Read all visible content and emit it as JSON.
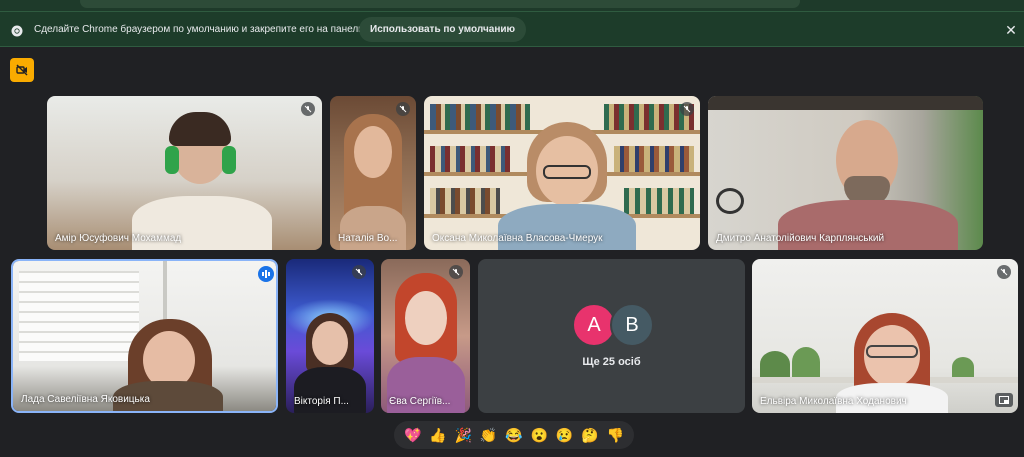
{
  "banner": {
    "message": "Сделайте Chrome браузером по умолчанию и закрепите его на панели задач.",
    "button_label": "Использовать по умолчанию",
    "close_glyph": "✕"
  },
  "participants": [
    {
      "name": "Амір Юсуфович Мохаммад",
      "muted": true
    },
    {
      "name": "Наталія Во...",
      "muted": true
    },
    {
      "name": "Оксана Миколаївна Власова-Чмерук",
      "muted": true
    },
    {
      "name": "Дмитро Анатолійович Карплянський",
      "muted": true
    },
    {
      "name": "Лада Савеліївна Яковицька",
      "speaking": true
    },
    {
      "name": "Вікторія П...",
      "muted": true
    },
    {
      "name": "Єва Сергіїв...",
      "muted": true
    },
    {
      "name": "Ельвіра Миколаївна Ходанович",
      "muted": true
    }
  ],
  "more_tile": {
    "avatars": [
      {
        "letter": "A",
        "color": "#e8336d"
      },
      {
        "letter": "B",
        "color": "#455a64"
      }
    ],
    "label": "Ще 25 осіб"
  },
  "reactions": [
    "💖",
    "👍",
    "🎉",
    "👏",
    "😂",
    "😮",
    "😢",
    "🤔",
    "👎"
  ],
  "colors": {
    "banner_bg": "#1d3c2a",
    "page_bg": "#202124",
    "speaking_border": "#8ab4f8",
    "badge": "#f9ab00"
  }
}
